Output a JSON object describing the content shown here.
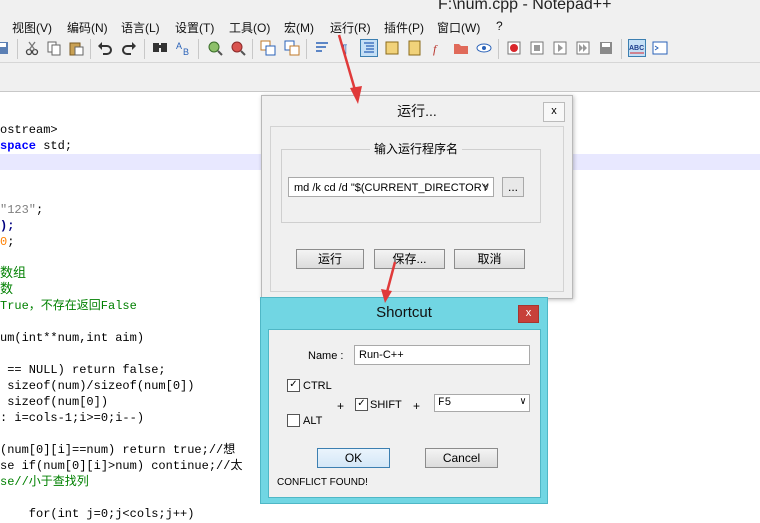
{
  "window": {
    "title": "F:\\num.cpp - Notepad++"
  },
  "menu": [
    "视图(V)",
    "编码(N)",
    "语言(L)",
    "设置(T)",
    "工具(O)",
    "宏(M)",
    "运行(R)",
    "插件(P)",
    "窗口(W)",
    "?"
  ],
  "code": {
    "l1": "ostream>",
    "l2a": "space",
    "l2b": " std;",
    "l5a": "\"123\"",
    "l5b": ";",
    "l6": ");",
    "l7a": "0",
    "l7b": ";",
    "l9": "数组",
    "l10": "数",
    "l11": "True，不存在返回False",
    "l13": "um(int**num,int aim)",
    "l15": " == NULL) return false;",
    "l16": " sizeof(num)/sizeof(num[0])",
    "l17": " sizeof(num[0])",
    "l18": ": i=cols-1;i>=0;i--)",
    "l20": "(num[0][i]==num) return true;//想",
    "l21": "se if(num[0][i]>num) continue;//太",
    "l22": "se//小于查找列",
    "l24": "    for(int j=0;j<cols;j++)"
  },
  "run_dialog": {
    "title": "运行...",
    "close": "x",
    "group_label": "输入运行程序名",
    "command_value": "md /k cd /d \"$(CURRENT_DIRECTORY",
    "browse": "...",
    "run_button": "运行",
    "save_button": "保存...",
    "cancel_button": "取消"
  },
  "shortcut_dialog": {
    "title": "Shortcut",
    "close": "x",
    "name_label": "Name :",
    "name_value": "Run-C++",
    "ctrl_label": "CTRL",
    "ctrl_checked": true,
    "alt_label": "ALT",
    "alt_checked": false,
    "plus1": "+",
    "shift_label": "SHIFT",
    "shift_checked": true,
    "plus2": "+",
    "key_value": "F5",
    "ok_button": "OK",
    "cancel_button": "Cancel",
    "status": "CONFLICT FOUND!"
  },
  "colors": {
    "shortcut_bg": "#71d6e3",
    "close_red": "#c7403a",
    "arrow_red": "#e03a3a"
  }
}
